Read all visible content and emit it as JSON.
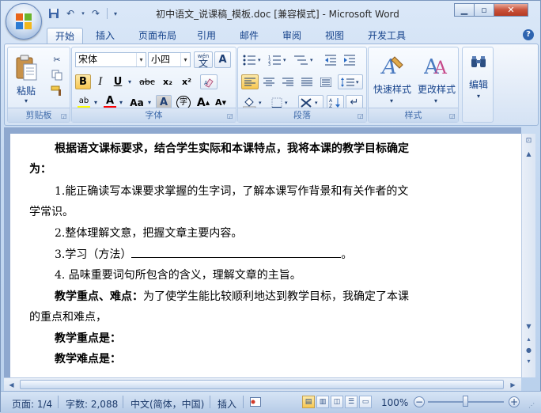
{
  "window": {
    "title": "初中语文_说课稿_模板.doc [兼容模式] - Microsoft Word"
  },
  "quick_access": {
    "items": [
      "save-icon",
      "undo-icon",
      "redo-icon",
      "customize-icon"
    ]
  },
  "tabs": [
    {
      "label": "开始",
      "active": true
    },
    {
      "label": "插入"
    },
    {
      "label": "页面布局"
    },
    {
      "label": "引用"
    },
    {
      "label": "邮件"
    },
    {
      "label": "审阅"
    },
    {
      "label": "视图"
    },
    {
      "label": "开发工具"
    }
  ],
  "ribbon": {
    "clipboard": {
      "group_label": "剪贴板",
      "paste_label": "粘贴"
    },
    "font": {
      "group_label": "字体",
      "font_name": "宋体",
      "font_size": "小四",
      "bold": "B",
      "italic": "I",
      "underline": "U",
      "strike": "abc",
      "subscript": "x₂",
      "superscript": "x²",
      "change_case": "Aa",
      "grow": "A",
      "shrink": "A",
      "char_border": "A",
      "enclose": "字",
      "phonetic": "wén",
      "phonetic_char": "文"
    },
    "paragraph": {
      "group_label": "段落"
    },
    "styles": {
      "group_label": "样式",
      "quick_styles": "快速样式",
      "change_styles": "更改样式"
    },
    "editing": {
      "label": "编辑"
    }
  },
  "document": {
    "paragraphs": [
      {
        "text": "根据语文课标要求，结合学生实际和本课特点，我将本课的教学目标确定",
        "style": "bold"
      },
      {
        "text": "为：",
        "style": "bold"
      },
      {
        "text": "1.能正确读写本课要求掌握的生字词，了解本课写作背景和有关作者的文"
      },
      {
        "text": "学常识。"
      },
      {
        "text": "2.整体理解文意，把握文章主要内容。"
      },
      {
        "text": "3.学习（方法）",
        "suffix": "。"
      },
      {
        "text": "4. 品味重要词句所包含的含义，理解文章的主旨。"
      },
      {
        "text_bold": "教学重点、难点：",
        "text": "为了使学生能比较顺利地达到教学目标，我确定了本课"
      },
      {
        "text": "的重点和难点，"
      },
      {
        "text": "教学重点是：",
        "style": "bold"
      },
      {
        "text": "教学难点是：",
        "style": "bold"
      }
    ]
  },
  "statusbar": {
    "page": "页面: 1/4",
    "words": "字数: 2,088",
    "language": "中文(简体，中国)",
    "insert_mode": "插入",
    "zoom": "100%"
  },
  "colors": {
    "highlight": "#ffff00",
    "font_color": "#ff0000",
    "accent": "#15428b"
  }
}
